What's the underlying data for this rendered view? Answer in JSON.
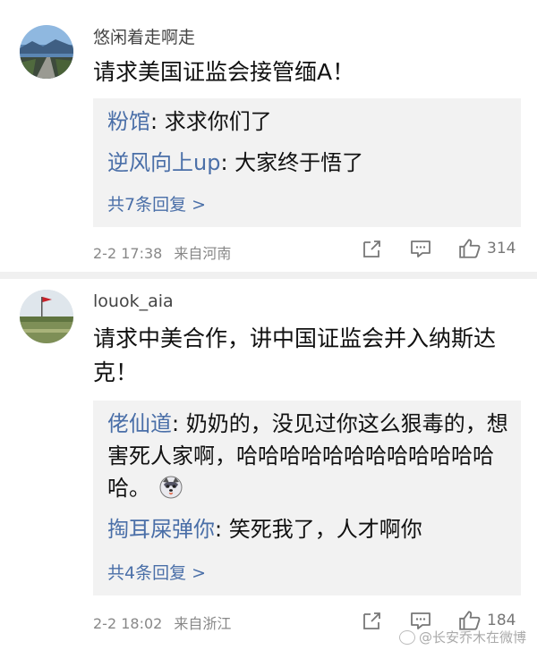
{
  "comments": [
    {
      "username": "悠闲着走啊走",
      "text": "请求美国证监会接管缅A！",
      "replies": [
        {
          "name": "粉馆",
          "text": "求求你们了"
        },
        {
          "name": "逆风向上up",
          "text": "大家终于悟了"
        }
      ],
      "more_replies": "共7条回复 >",
      "time": "2-2 17:38",
      "source": "来自河南",
      "likes": "314"
    },
    {
      "username": "louok_aia",
      "text": "请求中美合作，讲中国证监会并入纳斯达克！",
      "replies": [
        {
          "name": "佬仙道",
          "text": "奶奶的，没见过你这么狠毒的，想害死人家啊，哈哈哈哈哈哈哈哈哈哈哈哈哈。"
        },
        {
          "name": "掏耳屎弹你",
          "text": "笑死我了，人才啊你"
        }
      ],
      "more_replies": "共4条回复 >",
      "time": "2-2 18:02",
      "source": "来自浙江",
      "likes": "184"
    }
  ],
  "watermark": "@长安乔木在微博",
  "icons": [
    "share-icon",
    "comment-icon",
    "like-icon"
  ]
}
